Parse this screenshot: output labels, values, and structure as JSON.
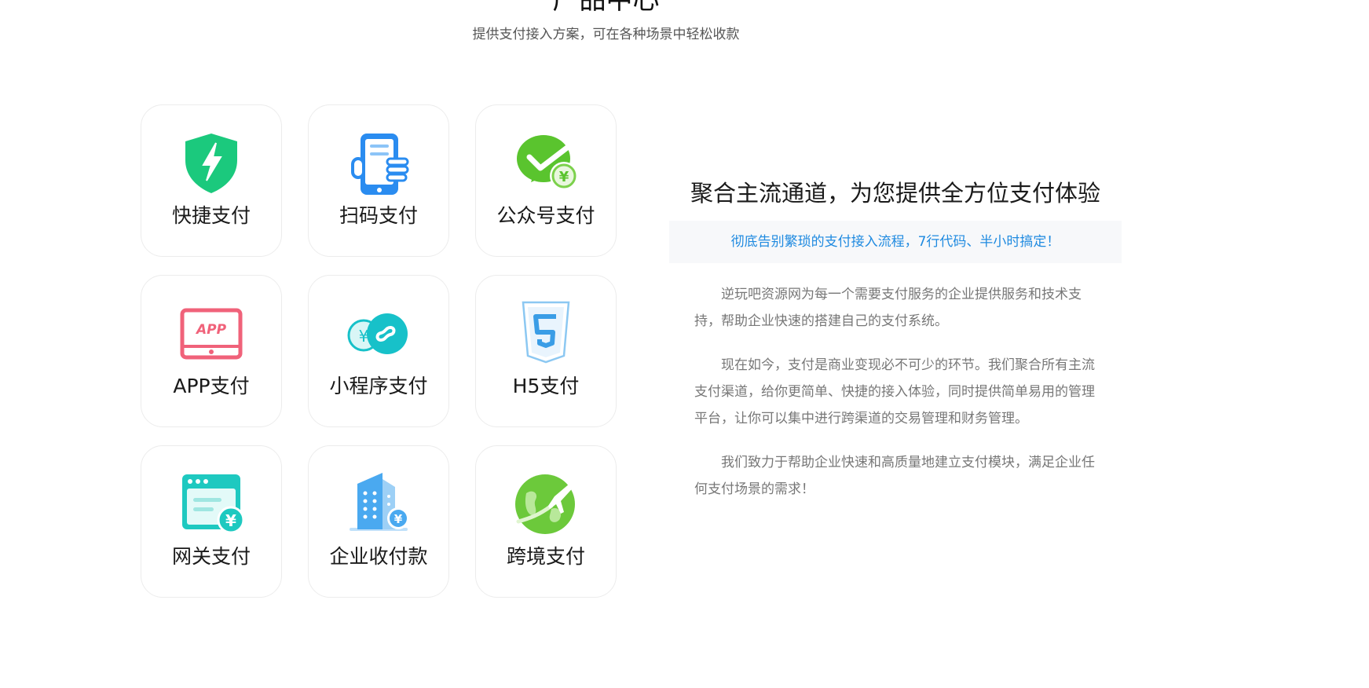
{
  "header": {
    "title": "产品中心",
    "subtitle": "提供支付接入方案，可在各种场景中轻松收款"
  },
  "products": [
    {
      "label": "快捷支付",
      "icon": "shield-lightning-icon",
      "color": "#1bc97d"
    },
    {
      "label": "扫码支付",
      "icon": "phone-scan-icon",
      "color": "#2a8cf0"
    },
    {
      "label": "公众号支付",
      "icon": "wechat-yuan-icon",
      "color": "#5ac42e"
    },
    {
      "label": "APP支付",
      "icon": "app-tablet-icon",
      "color": "#f0627a"
    },
    {
      "label": "小程序支付",
      "icon": "mini-program-icon",
      "color": "#17c1c9"
    },
    {
      "label": "H5支付",
      "icon": "html5-icon",
      "color": "#3a9de6"
    },
    {
      "label": "网关支付",
      "icon": "gateway-window-icon",
      "color": "#1ec9c0"
    },
    {
      "label": "企业收付款",
      "icon": "enterprise-building-icon",
      "color": "#4aa9f0"
    },
    {
      "label": "跨境支付",
      "icon": "globe-plane-icon",
      "color": "#6cc93b"
    }
  ],
  "info": {
    "heading": "聚合主流通道，为您提供全方位支付体验",
    "highlight": "彻底告别繁琐的支付接入流程，7行代码、半小时搞定！",
    "paragraphs": [
      "逆玩吧资源网为每一个需要支付服务的企业提供服务和技术支持，帮助企业快速的搭建自己的支付系统。",
      "现在如今，支付是商业变现必不可少的环节。我们聚合所有主流支付渠道，给你更简单、快捷的接入体验，同时提供简单易用的管理平台，让你可以集中进行跨渠道的交易管理和财务管理。",
      "我们致力于帮助企业快速和高质量地建立支付模块，满足企业任何支付场景的需求！"
    ]
  }
}
